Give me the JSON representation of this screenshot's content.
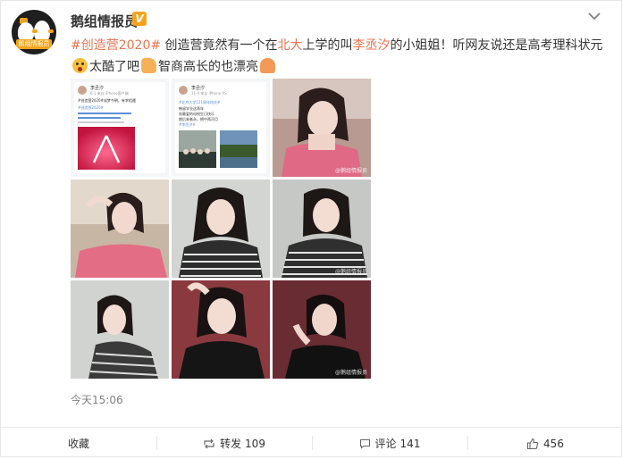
{
  "post": {
    "username": "鹅组情报员",
    "verified_badge": "V",
    "avatar_text": "鹅组情报员",
    "content": {
      "topic": "#创造营2020#",
      "part1": " 创造营竟然有一个在",
      "link1": "北大",
      "part2": "上学的叫",
      "link2": "李丞汐",
      "part3": "的小姐姐！听网友说还是高考理科状元",
      "part4": "太酷了吧",
      "part5": "智商高长的也漂亮"
    },
    "time": "今天15:06"
  },
  "screenshots": [
    {
      "name": "李丞汐",
      "meta": "6-1 来自 iPhone客户端",
      "line": "#创造营2020#成梦今朝，有幸相遇",
      "blue": "#创造营2020#"
    },
    {
      "name": "李丞汐",
      "meta": "11-4 来自 iPhone XS",
      "line1": "#北京大学121周年校庆#",
      "line2": "韩留学业这两年",
      "line3": "祝最爱的母校生日快乐",
      "line4": "期后来者永，拥中两河月",
      "blue": "#李丞汐#"
    }
  ],
  "watermark": "@鹅组情报员",
  "actions": {
    "favorite": "收藏",
    "repost_label": "转发",
    "repost_count": "109",
    "comment_label": "评论",
    "comment_count": "141",
    "like_count": "456"
  },
  "colors": {
    "accent": "#eb7350",
    "verified": "#f7a21b"
  },
  "icons": [
    "chevron-down-icon",
    "repost-icon",
    "comment-icon",
    "thumbs-up-icon"
  ]
}
